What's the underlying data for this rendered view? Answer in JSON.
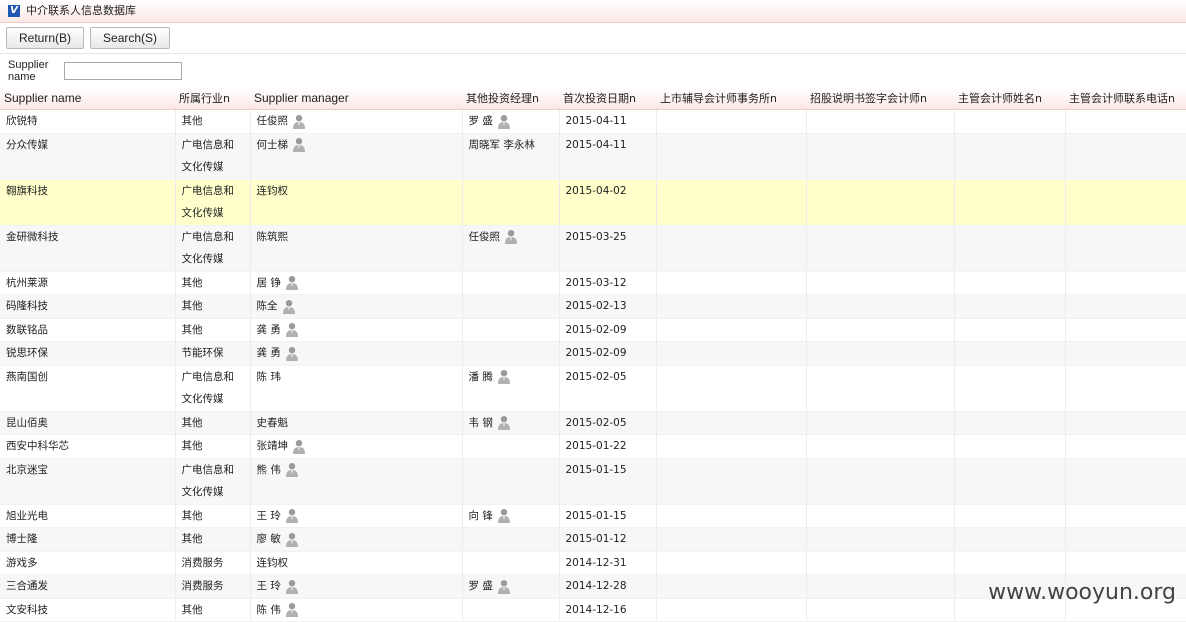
{
  "app": {
    "title": "中介联系人信息数据库",
    "logo_glyph": "V"
  },
  "toolbar": {
    "return_label": "Return(B)",
    "search_label": "Search(S)"
  },
  "search": {
    "label": "Supplier name",
    "value": ""
  },
  "table": {
    "headers": [
      "Supplier name",
      "所属行业n",
      "Supplier manager",
      "其他投资经理n",
      "首次投资日期n",
      "上市辅导会计师事务所n",
      "招股说明书签字会计师n",
      "主管会计师姓名n",
      "主管会计师联系电话n"
    ],
    "rows": [
      {
        "name": "欣锐特",
        "industry": "其他",
        "manager": "任俊照",
        "mgr_icon": true,
        "other": "罗 盛",
        "other_icon": true,
        "date": "2015-04-11"
      },
      {
        "name": "分众传媒",
        "industry": "广电信息和文化传媒",
        "manager": "何士梯",
        "mgr_icon": true,
        "other": "周晓军  李永林",
        "other_icon": false,
        "date": "2015-04-11"
      },
      {
        "name": "翱旗科技",
        "industry": "广电信息和文化传媒",
        "manager": "连钧权",
        "mgr_icon": false,
        "other": "",
        "other_icon": false,
        "date": "2015-04-02"
      },
      {
        "name": "金研微科技",
        "industry": "广电信息和文化传媒",
        "manager": "陈筑熙",
        "mgr_icon": false,
        "other": "任俊照",
        "other_icon": true,
        "date": "2015-03-25"
      },
      {
        "name": "杭州莱源",
        "industry": "其他",
        "manager": "居 铮",
        "mgr_icon": true,
        "other": "",
        "other_icon": false,
        "date": "2015-03-12"
      },
      {
        "name": "码隆科技",
        "industry": "其他",
        "manager": "陈全",
        "mgr_icon": true,
        "other": "",
        "other_icon": false,
        "date": "2015-02-13"
      },
      {
        "name": "数联铭品",
        "industry": "其他",
        "manager": "龚 勇",
        "mgr_icon": true,
        "other": "",
        "other_icon": false,
        "date": "2015-02-09"
      },
      {
        "name": "锐思环保",
        "industry": "节能环保",
        "manager": "龚 勇",
        "mgr_icon": true,
        "other": "",
        "other_icon": false,
        "date": "2015-02-09"
      },
      {
        "name": "燕南国创",
        "industry": "广电信息和文化传媒",
        "manager": "陈 玮",
        "mgr_icon": false,
        "other": "潘 腾",
        "other_icon": true,
        "date": "2015-02-05"
      },
      {
        "name": "昆山佰奥",
        "industry": "其他",
        "manager": "史春魁",
        "mgr_icon": false,
        "other": "韦 钢",
        "other_icon": true,
        "date": "2015-02-05"
      },
      {
        "name": "西安中科华芯",
        "industry": "其他",
        "manager": "张靖坤",
        "mgr_icon": true,
        "other": "",
        "other_icon": false,
        "date": "2015-01-22"
      },
      {
        "name": "北京迷宝",
        "industry": "广电信息和文化传媒",
        "manager": "熊 伟",
        "mgr_icon": true,
        "other": "",
        "other_icon": false,
        "date": "2015-01-15"
      },
      {
        "name": "旭业光电",
        "industry": "其他",
        "manager": "王 玲",
        "mgr_icon": true,
        "other": "向 锋",
        "other_icon": true,
        "date": "2015-01-15"
      },
      {
        "name": "博士隆",
        "industry": "其他",
        "manager": "廖 敏",
        "mgr_icon": true,
        "other": "",
        "other_icon": false,
        "date": "2015-01-12"
      },
      {
        "name": "游戏多",
        "industry": "消费服务",
        "manager": "连钧权",
        "mgr_icon": false,
        "other": "",
        "other_icon": false,
        "date": "2014-12-31"
      },
      {
        "name": "三合通发",
        "industry": "消费服务",
        "manager": "王 玲",
        "mgr_icon": true,
        "other": "罗 盛",
        "other_icon": true,
        "date": "2014-12-28"
      },
      {
        "name": "文安科技",
        "industry": "其他",
        "manager": "陈 伟",
        "mgr_icon": true,
        "other": "",
        "other_icon": false,
        "date": "2014-12-16"
      }
    ]
  },
  "watermark": "www.wooyun.org",
  "colors": {
    "highlight_row": "#ffffcc",
    "header_tint": "#fbe9e6",
    "logo": "#1f57b5"
  }
}
